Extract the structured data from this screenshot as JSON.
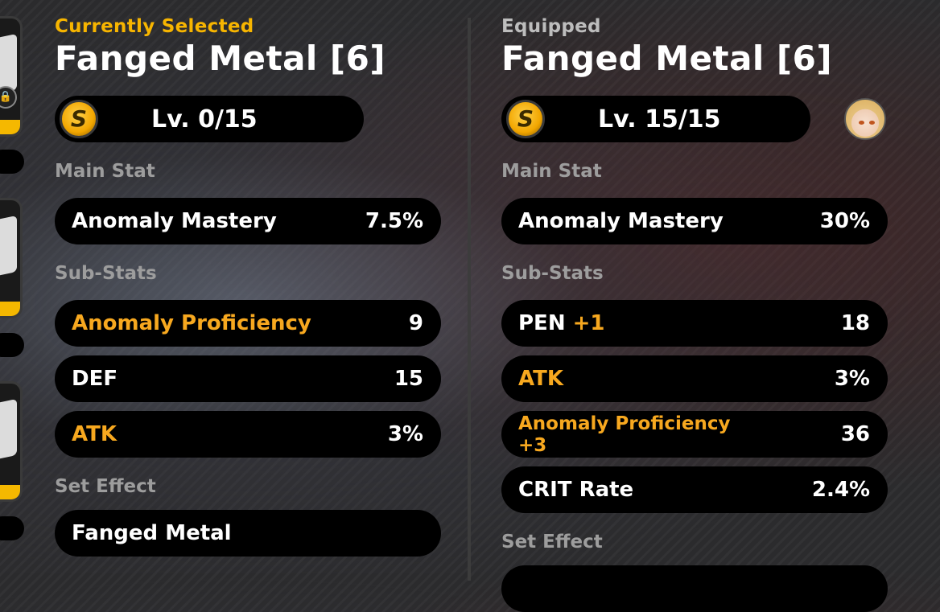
{
  "left": {
    "eyebrow": "Currently Selected",
    "title": "Fanged Metal [6]",
    "rank": "S",
    "level": "Lv. 0/15",
    "main_stat_heading": "Main Stat",
    "main_stat": {
      "name": "Anomaly Mastery",
      "value": "7.5%"
    },
    "sub_stats_heading": "Sub-Stats",
    "sub_stats": [
      {
        "name": "Anomaly Proficiency",
        "value": "9",
        "highlight": true
      },
      {
        "name": "DEF",
        "value": "15",
        "highlight": false
      },
      {
        "name": "ATK",
        "value": "3%",
        "highlight": true
      }
    ],
    "set_effect_heading": "Set Effect",
    "set_effect": "Fanged Metal"
  },
  "right": {
    "eyebrow": "Equipped",
    "title": "Fanged Metal [6]",
    "rank": "S",
    "level": "Lv. 15/15",
    "main_stat_heading": "Main Stat",
    "main_stat": {
      "name": "Anomaly Mastery",
      "value": "30%"
    },
    "sub_stats_heading": "Sub-Stats",
    "sub_stats": [
      {
        "name": "PEN",
        "upgrade": "+1",
        "value": "18",
        "highlight": false
      },
      {
        "name": "ATK",
        "upgrade": "",
        "value": "3%",
        "highlight": true
      },
      {
        "name": "Anomaly Proficiency",
        "upgrade": "+3",
        "value": "36",
        "highlight": true
      },
      {
        "name": "CRIT Rate",
        "upgrade": "",
        "value": "2.4%",
        "highlight": false
      }
    ],
    "set_effect_heading": "Set Effect"
  },
  "icons": {
    "rank": "s-rank-icon",
    "lock": "lock-icon",
    "avatar": "equipped-agent-avatar"
  },
  "colors": {
    "accent_gold": "#f7b500",
    "stat_highlight": "#f7a81f",
    "row_bg": "#000000",
    "heading_grey": "#9d9d9d"
  }
}
